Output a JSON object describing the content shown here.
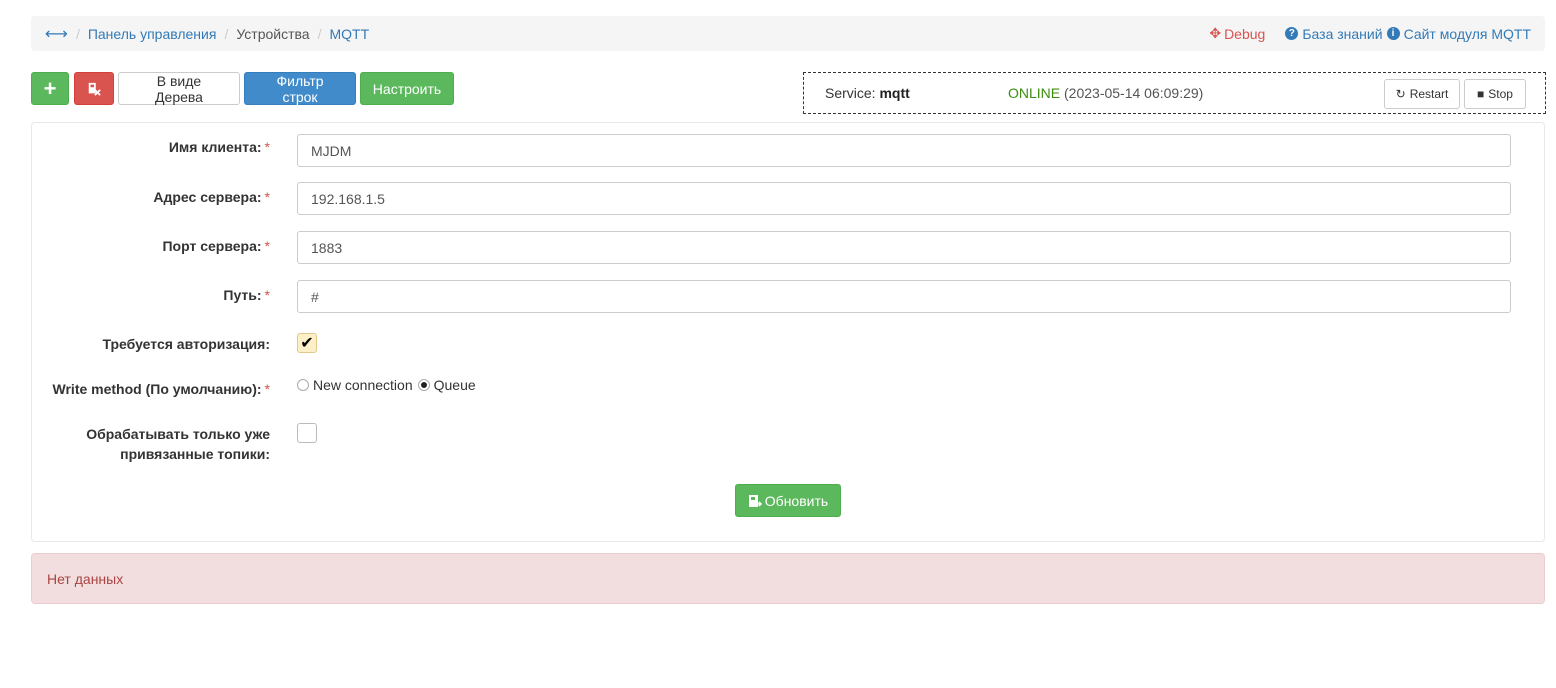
{
  "breadcrumb": {
    "home_icon": "horizontal-arrows-icon",
    "items": [
      {
        "label": "Панель управления",
        "link": true
      },
      {
        "label": "Устройства",
        "link": false
      },
      {
        "label": "MQTT",
        "link": true
      }
    ]
  },
  "top_links": {
    "debug": "Debug",
    "knowledge_base": "База знаний",
    "module_site": "Сайт модуля MQTT"
  },
  "toolbar": {
    "add_icon": "plus-icon",
    "delete_icon": "file-delete-icon",
    "tree_view": "В виде Дерева",
    "filter_rows": "Фильтр строк",
    "configure": "Настроить"
  },
  "service": {
    "label": "Service:",
    "name": "mqtt",
    "status": "ONLINE",
    "timestamp": "(2023-05-14 06:09:29)",
    "restart_label": "Restart",
    "stop_label": "Stop"
  },
  "form": {
    "client_name": {
      "label": "Имя клиента:",
      "value": "MJDM"
    },
    "server_address": {
      "label": "Адрес сервера:",
      "value": "192.168.1.5"
    },
    "server_port": {
      "label": "Порт сервера:",
      "value": "1883"
    },
    "path": {
      "label": "Путь:",
      "value": "#"
    },
    "auth_required": {
      "label": "Требуется авторизация:",
      "checked": true
    },
    "write_method": {
      "label": "Write method (По умолчанию):",
      "options": [
        "New connection",
        "Queue"
      ],
      "selected": "Queue"
    },
    "only_bound_topics": {
      "label_line1": "Обрабатывать только уже",
      "label_line2": "привязанные топики:",
      "checked": false
    },
    "update_button": "Обновить"
  },
  "alert": {
    "message": "Нет данных"
  },
  "colors": {
    "primary": "#428bca",
    "success": "#5cb85c",
    "danger": "#d9534f",
    "online": "#3c8d0e",
    "alert_bg": "#f2dede"
  }
}
